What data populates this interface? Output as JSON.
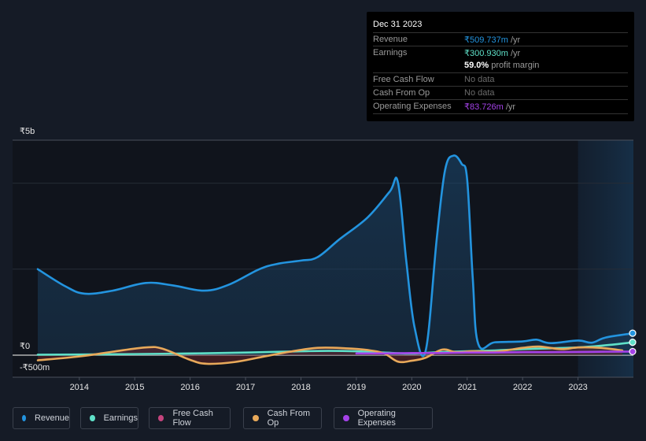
{
  "tooltip": {
    "date": "Dec 31 2023",
    "rows": [
      {
        "label": "Revenue",
        "value": "₹509.737m",
        "suffix": " /yr",
        "color": "#2394df"
      },
      {
        "label": "Earnings",
        "value": "₹300.930m",
        "suffix": " /yr",
        "color": "#5fe0c8"
      },
      {
        "label": "",
        "value": "59.0%",
        "suffix": " profit margin",
        "color": "#ffffff"
      },
      {
        "label": "Free Cash Flow",
        "value": "No data",
        "suffix": "",
        "color": "#6b6b6b"
      },
      {
        "label": "Cash From Op",
        "value": "No data",
        "suffix": "",
        "color": "#6b6b6b"
      },
      {
        "label": "Operating Expenses",
        "value": "₹83.726m",
        "suffix": " /yr",
        "color": "#a442e8"
      }
    ]
  },
  "legend": [
    {
      "label": "Revenue",
      "color": "#2394df"
    },
    {
      "label": "Earnings",
      "color": "#5fe0c8"
    },
    {
      "label": "Free Cash Flow",
      "color": "#c4447d"
    },
    {
      "label": "Cash From Op",
      "color": "#e8a95a"
    },
    {
      "label": "Operating Expenses",
      "color": "#a442e8"
    }
  ],
  "chart_data": {
    "type": "line",
    "title": "",
    "xlabel": "",
    "ylabel": "",
    "currency": "₹",
    "y_tick_labels": [
      "₹5b",
      "₹0",
      "-₹500m"
    ],
    "y_ticks": [
      5000,
      0,
      -500
    ],
    "ylim": [
      -500,
      5000
    ],
    "xlim": [
      2013.25,
      2024.0
    ],
    "x_tick_labels": [
      "2014",
      "2015",
      "2016",
      "2017",
      "2018",
      "2019",
      "2020",
      "2021",
      "2022",
      "2023"
    ],
    "x_ticks": [
      2014,
      2015,
      2016,
      2017,
      2018,
      2019,
      2020,
      2021,
      2022,
      2023
    ],
    "highlight_region": [
      2023.0,
      2024.0
    ],
    "grid": true,
    "legend_position": "bottom-left",
    "series": [
      {
        "name": "Revenue",
        "color": "#2394df",
        "fill": true,
        "x": [
          2013.25,
          2013.75,
          2014.1,
          2014.6,
          2015.2,
          2015.7,
          2016.25,
          2016.7,
          2017.25,
          2017.6,
          2018.0,
          2018.3,
          2018.7,
          2019.2,
          2019.6,
          2019.75,
          2019.9,
          2020.05,
          2020.25,
          2020.45,
          2020.6,
          2020.75,
          2020.9,
          2021.0,
          2021.1,
          2021.2,
          2021.5,
          2022.0,
          2022.25,
          2022.5,
          2023.0,
          2023.25,
          2023.5,
          2024.0
        ],
        "values": [
          2000,
          1600,
          1430,
          1500,
          1680,
          1620,
          1500,
          1640,
          2000,
          2130,
          2200,
          2280,
          2700,
          3200,
          3800,
          4020,
          2200,
          650,
          100,
          2700,
          4300,
          4640,
          4450,
          4080,
          1800,
          260,
          300,
          320,
          360,
          280,
          340,
          290,
          410,
          510
        ]
      },
      {
        "name": "Earnings",
        "color": "#5fe0c8",
        "fill": false,
        "x": [
          2013.25,
          2014.0,
          2015.0,
          2016.0,
          2017.0,
          2018.0,
          2018.5,
          2019.0,
          2019.5,
          2020.0,
          2020.5,
          2021.0,
          2021.5,
          2022.0,
          2022.5,
          2023.0,
          2023.5,
          2024.0
        ],
        "values": [
          10,
          15,
          25,
          40,
          60,
          90,
          100,
          90,
          60,
          40,
          70,
          90,
          110,
          140,
          160,
          180,
          230,
          300
        ]
      },
      {
        "name": "Free Cash Flow",
        "color": "#c4447d",
        "fill": false,
        "x": [],
        "values": []
      },
      {
        "name": "Cash From Op",
        "color": "#e8a95a",
        "fill": true,
        "x": [
          2013.25,
          2014.0,
          2014.6,
          2015.2,
          2015.5,
          2016.0,
          2016.3,
          2016.8,
          2017.3,
          2017.8,
          2018.3,
          2018.8,
          2019.2,
          2019.5,
          2019.75,
          2020.0,
          2020.25,
          2020.55,
          2020.8,
          2021.1,
          2021.5,
          2022.0,
          2022.3,
          2022.7,
          2023.0,
          2023.4,
          2023.8
        ],
        "values": [
          -120,
          -30,
          80,
          180,
          150,
          -110,
          -200,
          -160,
          -40,
          80,
          170,
          160,
          120,
          40,
          -150,
          -130,
          -60,
          130,
          70,
          90,
          80,
          170,
          200,
          140,
          180,
          170,
          110
        ]
      },
      {
        "name": "Operating Expenses",
        "color": "#a442e8",
        "fill": false,
        "x": [
          2019.0,
          2019.5,
          2020.0,
          2020.5,
          2021.0,
          2021.5,
          2022.0,
          2022.5,
          2023.0,
          2023.5,
          2024.0
        ],
        "values": [
          40,
          40,
          50,
          50,
          60,
          60,
          70,
          70,
          75,
          80,
          84
        ]
      }
    ]
  }
}
